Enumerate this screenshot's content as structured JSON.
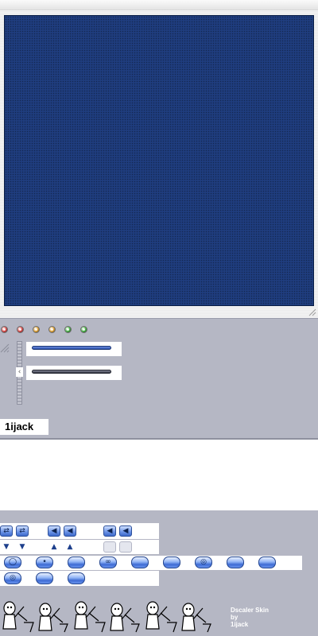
{
  "panel": {
    "indicator_colors": [
      "#d94040",
      "#d94040",
      "#e0a030",
      "#e0a030",
      "#40b040",
      "#40b040"
    ],
    "slider_track_colors": [
      "#3a5fb8",
      "#3a3d4c"
    ],
    "name_tag": "1ijack"
  },
  "sprite_sheet": {
    "row1_icons": [
      "swap-icon",
      "swap-icon",
      "volume-icon",
      "volume-icon",
      "speaker-icon",
      "speaker-icon"
    ],
    "row2_icons": [
      "triangle-down-icon",
      "triangle-down-icon",
      "triangle-up-icon",
      "triangle-up-icon",
      "square-disabled-icon",
      "square-disabled-icon"
    ],
    "row3_icons": [
      "circle-icon",
      "dot-icon",
      "blank-icon",
      "infinity-icon",
      "blank-icon",
      "blank-icon",
      "circle-pair-icon",
      "blank-icon",
      "blank-icon"
    ],
    "row4_icons": [
      "circle-pair-icon",
      "blank-icon",
      "blank-icon"
    ],
    "glyphs": {
      "swap": "⇄",
      "volume": "◀",
      "down": "▼",
      "up": "▲",
      "circle": "◯",
      "dot": "•",
      "infinity": "∞",
      "pair": "◎"
    }
  },
  "footer": {
    "credit_title": "Dscaler Skin",
    "credit_by": "by",
    "credit_author": "1ijack"
  },
  "colors": {
    "video_blue": "#1f3d7e",
    "panel_gray": "#b5b7c4",
    "button_blue": "#3d6acb"
  }
}
